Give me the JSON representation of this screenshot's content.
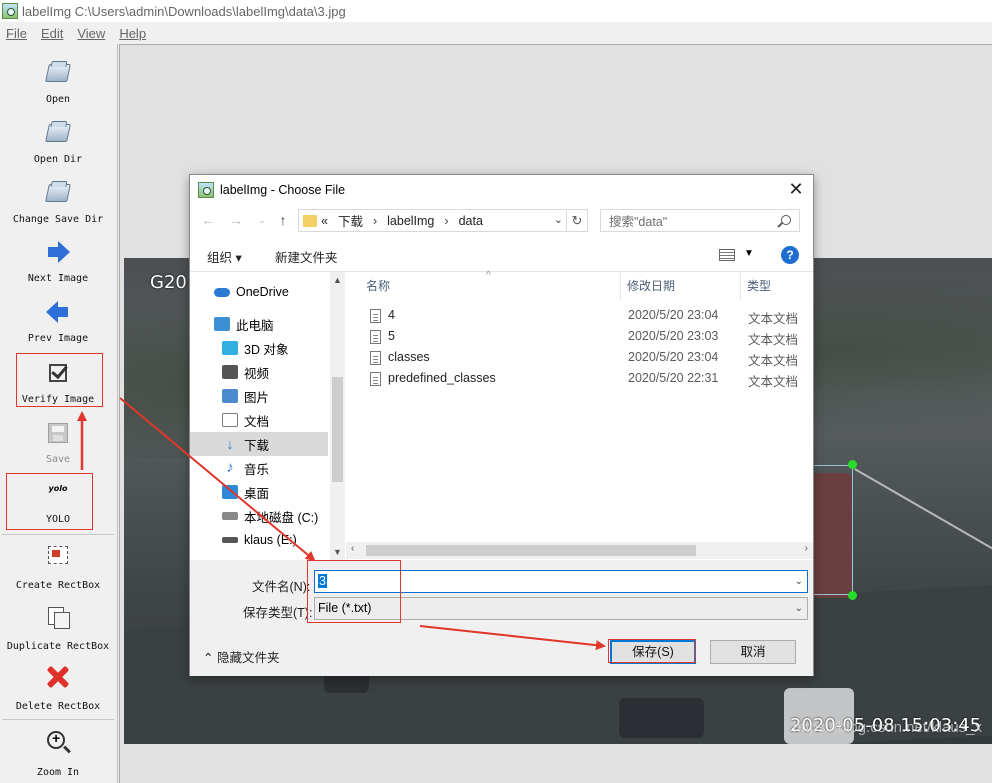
{
  "window": {
    "title": "labelImg C:\\Users\\admin\\Downloads\\labelImg\\data\\3.jpg"
  },
  "menu": [
    "File",
    "Edit",
    "View",
    "Help"
  ],
  "toolbar": {
    "open": "Open",
    "open_dir": "Open Dir",
    "change_save_dir": "Change Save Dir",
    "next_image": "Next Image",
    "prev_image": "Prev Image",
    "verify_image": "Verify Image",
    "save": "Save",
    "yolo_icon_text": "yolo",
    "yolo": "YOLO",
    "create_rectbox": "Create RectBox",
    "duplicate_rectbox": "Duplicate RectBox",
    "delete_rectbox": "Delete RectBox",
    "zoom_in": "Zoom In"
  },
  "image": {
    "overlay_left": "G20",
    "timestamp": "2020-05-08 15:03:45",
    "watermark": "https://blog.csdn.net/klaus_x"
  },
  "dialog": {
    "title": "labelImg - Choose File",
    "breadcrumb": [
      "«",
      "下载",
      "›",
      "labelImg",
      "›",
      "data"
    ],
    "search_placeholder": "搜索\"data\"",
    "organize": "组织 ▾",
    "new_folder": "新建文件夹",
    "nav": [
      {
        "label": "OneDrive",
        "color": "#2a7ad4"
      },
      {
        "label": "此电脑",
        "color": "#3d8fd4"
      },
      {
        "label": "3D 对象",
        "color": "#2fb0e0"
      },
      {
        "label": "视频",
        "color": "#555555"
      },
      {
        "label": "图片",
        "color": "#4d8bd0"
      },
      {
        "label": "文档",
        "color": "#7a7a7a"
      },
      {
        "label": "下载",
        "color": "#2a7ad4"
      },
      {
        "label": "音乐",
        "color": "#2a7ad4"
      },
      {
        "label": "桌面",
        "color": "#2f87d8"
      },
      {
        "label": "本地磁盘 (C:)",
        "color": "#888888"
      },
      {
        "label": "klaus (E:)",
        "color": "#555555"
      }
    ],
    "columns": {
      "name": "名称",
      "date": "修改日期",
      "type": "类型"
    },
    "files": [
      {
        "name": "4",
        "date": "2020/5/20 23:04",
        "type": "文本文档"
      },
      {
        "name": "5",
        "date": "2020/5/20 23:03",
        "type": "文本文档"
      },
      {
        "name": "classes",
        "date": "2020/5/20 23:04",
        "type": "文本文档"
      },
      {
        "name": "predefined_classes",
        "date": "2020/5/20 22:31",
        "type": "文本文档"
      }
    ],
    "filename_label": "文件名(N):",
    "filename_value": "3",
    "filetype_label": "保存类型(T):",
    "filetype_value": "File (*.txt)",
    "hide_folders": "隐藏文件夹",
    "save_button": "保存(S)",
    "cancel_button": "取消"
  },
  "colors": {
    "annotation_red": "#e0362c",
    "accent_blue": "#0078d7"
  }
}
